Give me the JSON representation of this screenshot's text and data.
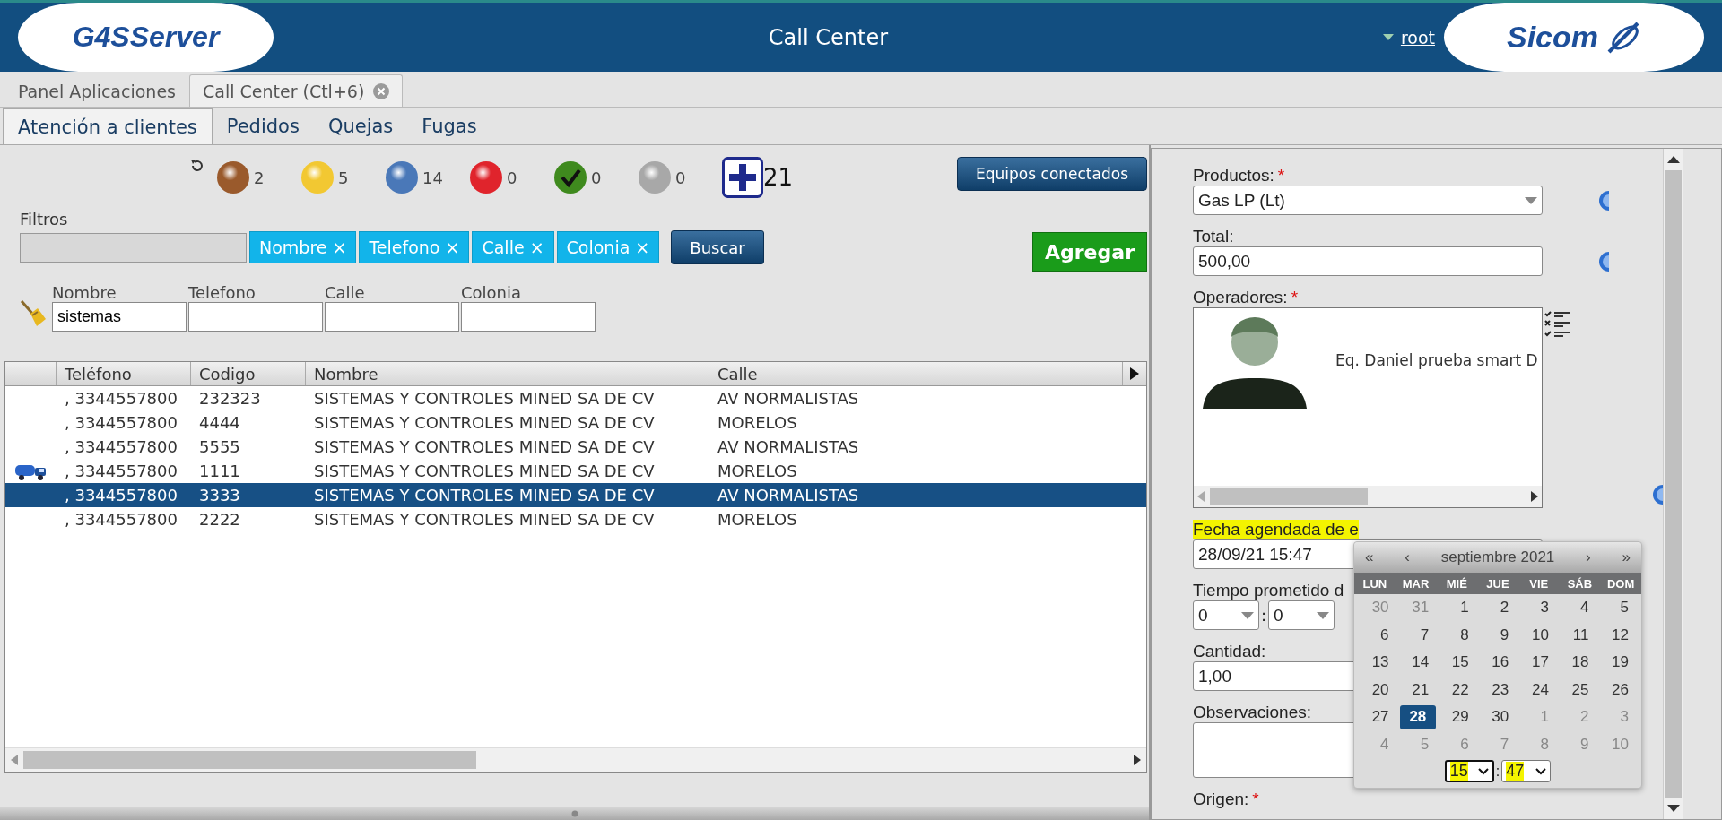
{
  "header": {
    "logo_left": "G4SServer",
    "title": "Call Center",
    "user": "root",
    "logo_right": "Sicom"
  },
  "app_tabs": [
    {
      "label": "Panel Aplicaciones",
      "selected": false,
      "closable": false
    },
    {
      "label": "Call Center (Ctl+6)",
      "selected": true,
      "closable": true
    }
  ],
  "section_tabs": [
    {
      "label": "Atención a clientes",
      "selected": true
    },
    {
      "label": "Pedidos",
      "selected": false
    },
    {
      "label": "Quejas",
      "selected": false
    },
    {
      "label": "Fugas",
      "selected": false
    }
  ],
  "status_counts": [
    {
      "kind": "ball",
      "color": "#9a5a2c",
      "count": "2"
    },
    {
      "kind": "ball",
      "color": "#f2c832",
      "count": "5"
    },
    {
      "kind": "ball",
      "color": "#4a78b8",
      "count": "14"
    },
    {
      "kind": "ball",
      "color": "#e0242c",
      "count": "0"
    },
    {
      "kind": "check",
      "color": "#3f8a1e",
      "count": "0"
    },
    {
      "kind": "ball",
      "color": "#a8a8a8",
      "count": "0"
    }
  ],
  "add_counter": "21",
  "connected_button": "Equipos conectados",
  "filters": {
    "label": "Filtros",
    "chips": [
      "Nombre ×",
      "Telefono ×",
      "Calle ×",
      "Colonia ×"
    ],
    "search_button": "Buscar"
  },
  "add_button": "Agregar",
  "search_fields": [
    {
      "label": "Nombre",
      "value": "sistemas"
    },
    {
      "label": "Telefono"
    },
    {
      "label": "Calle"
    },
    {
      "label": "Colonia"
    }
  ],
  "table": {
    "columns": [
      "Teléfono",
      "Codigo",
      "Nombre",
      "Calle"
    ],
    "rows": [
      {
        "cells": [
          ", 3344557800",
          "232323",
          "SISTEMAS Y CONTROLES MINED SA DE CV",
          "AV NORMALISTAS"
        ],
        "selected": false,
        "flagged": false
      },
      {
        "cells": [
          ", 3344557800",
          "4444",
          "SISTEMAS Y CONTROLES MINED SA DE CV",
          "MORELOS"
        ],
        "selected": false,
        "flagged": false
      },
      {
        "cells": [
          ", 3344557800",
          "5555",
          "SISTEMAS Y CONTROLES MINED SA DE CV",
          "AV NORMALISTAS"
        ],
        "selected": false,
        "flagged": false
      },
      {
        "cells": [
          ", 3344557800",
          "1111",
          "SISTEMAS Y CONTROLES MINED SA DE CV",
          "MORELOS"
        ],
        "selected": false,
        "flagged": true
      },
      {
        "cells": [
          ", 3344557800",
          "3333",
          "SISTEMAS Y CONTROLES MINED SA DE CV",
          "AV NORMALISTAS"
        ],
        "selected": true,
        "flagged": false
      },
      {
        "cells": [
          ", 3344557800",
          "2222",
          "SISTEMAS Y CONTROLES MINED SA DE CV",
          "MORELOS"
        ],
        "selected": false,
        "flagged": false
      }
    ]
  },
  "form": {
    "fields": [
      {
        "kind": "select",
        "label": "Productos:",
        "required_mark": "*",
        "value": "Gas LP (Lt)",
        "info": true
      },
      {
        "kind": "input",
        "label": "Total:",
        "value": "500,00",
        "info": true
      },
      {
        "kind": "operators",
        "label": "Operadores:",
        "required_mark": "*",
        "operator": "Eq. Daniel prueba smart D",
        "info": true
      },
      {
        "kind": "input",
        "label": "Fecha agendada de e",
        "highlighted": true,
        "value": "28/09/21 15:47"
      },
      {
        "kind": "time_pair",
        "label": "Tiempo prometido d",
        "hours": "0",
        "minutes": "0",
        "separator": ":"
      },
      {
        "kind": "input",
        "label": "Cantidad:",
        "value": "1,00"
      },
      {
        "kind": "textarea",
        "label": "Observaciones:"
      },
      {
        "kind": "label",
        "label": "Origen:",
        "required_mark": "*"
      }
    ]
  },
  "calendar": {
    "prev_year": "«",
    "prev_month": "‹",
    "title": "septiembre 2021",
    "next_month": "›",
    "next_year": "»",
    "weekdays": [
      "LUN",
      "MAR",
      "MIÉ",
      "JUE",
      "VIE",
      "SÁB",
      "DOM"
    ],
    "weeks": [
      [
        {
          "label": "30",
          "muted": true,
          "selected": false
        },
        {
          "label": "31",
          "muted": true,
          "selected": false
        },
        {
          "label": "1",
          "muted": false,
          "selected": false
        },
        {
          "label": "2",
          "muted": false,
          "selected": false
        },
        {
          "label": "3",
          "muted": false,
          "selected": false
        },
        {
          "label": "4",
          "muted": false,
          "selected": false
        },
        {
          "label": "5",
          "muted": false,
          "selected": false
        }
      ],
      [
        {
          "label": "6",
          "muted": false,
          "selected": false
        },
        {
          "label": "7",
          "muted": false,
          "selected": false
        },
        {
          "label": "8",
          "muted": false,
          "selected": false
        },
        {
          "label": "9",
          "muted": false,
          "selected": false
        },
        {
          "label": "10",
          "muted": false,
          "selected": false
        },
        {
          "label": "11",
          "muted": false,
          "selected": false
        },
        {
          "label": "12",
          "muted": false,
          "selected": false
        }
      ],
      [
        {
          "label": "13",
          "muted": false,
          "selected": false
        },
        {
          "label": "14",
          "muted": false,
          "selected": false
        },
        {
          "label": "15",
          "muted": false,
          "selected": false
        },
        {
          "label": "16",
          "muted": false,
          "selected": false
        },
        {
          "label": "17",
          "muted": false,
          "selected": false
        },
        {
          "label": "18",
          "muted": false,
          "selected": false
        },
        {
          "label": "19",
          "muted": false,
          "selected": false
        }
      ],
      [
        {
          "label": "20",
          "muted": false,
          "selected": false
        },
        {
          "label": "21",
          "muted": false,
          "selected": false
        },
        {
          "label": "22",
          "muted": false,
          "selected": false
        },
        {
          "label": "23",
          "muted": false,
          "selected": false
        },
        {
          "label": "24",
          "muted": false,
          "selected": false
        },
        {
          "label": "25",
          "muted": false,
          "selected": false
        },
        {
          "label": "26",
          "muted": false,
          "selected": false
        }
      ],
      [
        {
          "label": "27",
          "muted": false,
          "selected": false
        },
        {
          "label": "28",
          "muted": false,
          "selected": true
        },
        {
          "label": "29",
          "muted": false,
          "selected": false
        },
        {
          "label": "30",
          "muted": false,
          "selected": false
        },
        {
          "label": "1",
          "muted": true,
          "selected": false
        },
        {
          "label": "2",
          "muted": true,
          "selected": false
        },
        {
          "label": "3",
          "muted": true,
          "selected": false
        }
      ],
      [
        {
          "label": "4",
          "muted": true,
          "selected": false
        },
        {
          "label": "5",
          "muted": true,
          "selected": false
        },
        {
          "label": "6",
          "muted": true,
          "selected": false
        },
        {
          "label": "7",
          "muted": true,
          "selected": false
        },
        {
          "label": "8",
          "muted": true,
          "selected": false
        },
        {
          "label": "9",
          "muted": true,
          "selected": false
        },
        {
          "label": "10",
          "muted": true,
          "selected": false
        }
      ]
    ],
    "hour": "15",
    "minute": "47",
    "separator": ":"
  }
}
